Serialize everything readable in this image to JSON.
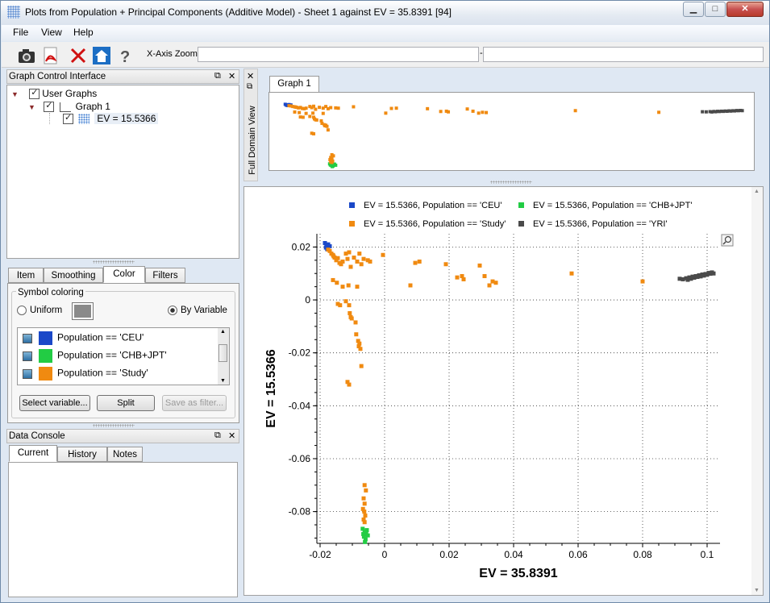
{
  "window": {
    "title": "Plots from Population + Principal Components (Additive Model) - Sheet 1 against EV = 35.8391 [94]",
    "min_label": "▁",
    "max_label": "□",
    "close_label": "✕"
  },
  "menu": [
    "File",
    "View",
    "Help"
  ],
  "toolbar": {
    "icons": [
      "camera-icon",
      "pdf-icon",
      "delete-icon",
      "home-icon",
      "help-icon"
    ],
    "xzoom_label": "X-Axis Zoom",
    "xzoom_min": "",
    "xzoom_max": "",
    "xzoom_sep": "-"
  },
  "graph_control": {
    "title": "Graph Control Interface",
    "tree": {
      "root": "User Graphs",
      "graph": "Graph 1",
      "series": "EV = 15.5366"
    }
  },
  "property_tabs": [
    "Item",
    "Smoothing",
    "Color",
    "Filters"
  ],
  "color_tab": {
    "group_title": "Symbol coloring",
    "uniform_label": "Uniform",
    "by_variable_label": "By Variable",
    "entries": [
      {
        "label": "Population == 'CEU'",
        "color": "#1a48c8"
      },
      {
        "label": "Population == 'CHB+JPT'",
        "color": "#22cc44"
      },
      {
        "label": "Population == 'Study'",
        "color": "#f08a10"
      }
    ],
    "buttons": {
      "select": "Select variable...",
      "split": "Split",
      "save": "Save as filter..."
    }
  },
  "data_console": {
    "title": "Data Console",
    "tabs": [
      "Current",
      "History",
      "Notes"
    ]
  },
  "full_domain": {
    "side_label": "Full Domain View",
    "tab": "Graph 1"
  },
  "chart_data": {
    "type": "scatter",
    "xlabel": "EV = 35.8391",
    "ylabel": "EV = 15.5366",
    "xlim": [
      -0.021,
      0.104
    ],
    "ylim": [
      -0.092,
      0.025
    ],
    "xticks": [
      "-0.02",
      "0",
      "0.02",
      "0.04",
      "0.06",
      "0.08",
      "0.1"
    ],
    "xtick_values": [
      -0.02,
      0,
      0.02,
      0.04,
      0.06,
      0.08,
      0.1
    ],
    "yticks": [
      "0.02",
      "0",
      "-0.02",
      "-0.04",
      "-0.06",
      "-0.08"
    ],
    "ytick_values": [
      0.02,
      0,
      -0.02,
      -0.04,
      -0.06,
      -0.08
    ],
    "grid": true,
    "legend": "top",
    "series": [
      {
        "name": "EV = 15.5366, Population == 'CEU'",
        "color": "#1a48c8",
        "points": [
          [
            -0.0185,
            0.0215
          ],
          [
            -0.018,
            0.0205
          ],
          [
            -0.0175,
            0.021
          ],
          [
            -0.0182,
            0.0198
          ],
          [
            -0.0178,
            0.0192
          ],
          [
            -0.017,
            0.0203
          ]
        ]
      },
      {
        "name": "EV = 15.5366, Population == 'CHB+JPT'",
        "color": "#22cc44",
        "points": [
          [
            -0.0068,
            -0.0865
          ],
          [
            -0.0062,
            -0.0875
          ],
          [
            -0.0057,
            -0.0885
          ],
          [
            -0.0064,
            -0.0895
          ],
          [
            -0.0059,
            -0.0905
          ],
          [
            -0.0055,
            -0.087
          ],
          [
            -0.0066,
            -0.0885
          ],
          [
            -0.0052,
            -0.089
          ],
          [
            -0.0061,
            -0.0915
          ]
        ]
      },
      {
        "name": "EV = 15.5366, Population == 'Study'",
        "color": "#f08a10",
        "points": [
          [
            -0.0175,
            0.019
          ],
          [
            -0.017,
            0.0185
          ],
          [
            -0.0165,
            0.0175
          ],
          [
            -0.016,
            0.017
          ],
          [
            -0.0158,
            0.0165
          ],
          [
            -0.0155,
            0.016
          ],
          [
            -0.015,
            0.015
          ],
          [
            -0.0145,
            0.0158
          ],
          [
            -0.014,
            0.014
          ],
          [
            -0.0135,
            0.0135
          ],
          [
            -0.013,
            0.0145
          ],
          [
            -0.012,
            0.0175
          ],
          [
            -0.0115,
            0.0155
          ],
          [
            -0.011,
            0.018
          ],
          [
            -0.0105,
            0.0125
          ],
          [
            -0.0095,
            0.016
          ],
          [
            -0.0085,
            0.0145
          ],
          [
            -0.0078,
            0.0175
          ],
          [
            -0.0072,
            0.0135
          ],
          [
            -0.0065,
            0.0155
          ],
          [
            -0.0052,
            0.015
          ],
          [
            -0.0045,
            0.0145
          ],
          [
            -0.0005,
            0.017
          ],
          [
            0.0095,
            0.014
          ],
          [
            0.0108,
            0.0145
          ],
          [
            0.019,
            0.0135
          ],
          [
            0.0225,
            0.0085
          ],
          [
            0.024,
            0.009
          ],
          [
            0.0245,
            0.0078
          ],
          [
            0.0295,
            0.013
          ],
          [
            0.031,
            0.009
          ],
          [
            0.0325,
            0.0055
          ],
          [
            0.0335,
            0.007
          ],
          [
            0.0345,
            0.0065
          ],
          [
            0.058,
            0.01
          ],
          [
            0.08,
            0.007
          ],
          [
            0.008,
            0.0055
          ],
          [
            -0.016,
            0.0075
          ],
          [
            -0.0148,
            0.0065
          ],
          [
            -0.013,
            0.005
          ],
          [
            -0.0112,
            0.0055
          ],
          [
            -0.0085,
            0.005
          ],
          [
            -0.0145,
            -0.0015
          ],
          [
            -0.0138,
            -0.002
          ],
          [
            -0.012,
            -0.0005
          ],
          [
            -0.011,
            -0.002
          ],
          [
            -0.0108,
            -0.005
          ],
          [
            -0.0105,
            -0.0065
          ],
          [
            -0.0102,
            -0.007
          ],
          [
            -0.009,
            -0.0085
          ],
          [
            -0.0088,
            -0.013
          ],
          [
            -0.0082,
            -0.0155
          ],
          [
            -0.0078,
            -0.0165
          ],
          [
            -0.008,
            -0.0175
          ],
          [
            -0.0075,
            -0.0185
          ],
          [
            -0.0072,
            -0.025
          ],
          [
            -0.0115,
            -0.031
          ],
          [
            -0.011,
            -0.032
          ],
          [
            -0.0062,
            -0.07
          ],
          [
            -0.0058,
            -0.072
          ],
          [
            -0.0065,
            -0.075
          ],
          [
            -0.0062,
            -0.077
          ],
          [
            -0.0067,
            -0.079
          ],
          [
            -0.0063,
            -0.08
          ],
          [
            -0.006,
            -0.0815
          ],
          [
            -0.0065,
            -0.083
          ],
          [
            -0.0062,
            -0.084
          ]
        ]
      },
      {
        "name": "EV = 15.5366, Population == 'YRI'",
        "color": "#4a4a4a",
        "points": [
          [
            0.0915,
            0.008
          ],
          [
            0.0925,
            0.0078
          ],
          [
            0.0935,
            0.0082
          ],
          [
            0.094,
            0.0076
          ],
          [
            0.0945,
            0.0085
          ],
          [
            0.095,
            0.008
          ],
          [
            0.0955,
            0.0088
          ],
          [
            0.096,
            0.0084
          ],
          [
            0.0965,
            0.009
          ],
          [
            0.097,
            0.0087
          ],
          [
            0.0975,
            0.0093
          ],
          [
            0.098,
            0.0089
          ],
          [
            0.0985,
            0.0096
          ],
          [
            0.099,
            0.0092
          ],
          [
            0.0995,
            0.0098
          ],
          [
            0.1,
            0.0095
          ],
          [
            0.1005,
            0.0102
          ],
          [
            0.101,
            0.0099
          ],
          [
            0.1015,
            0.0104
          ],
          [
            0.102,
            0.01
          ]
        ]
      }
    ]
  }
}
